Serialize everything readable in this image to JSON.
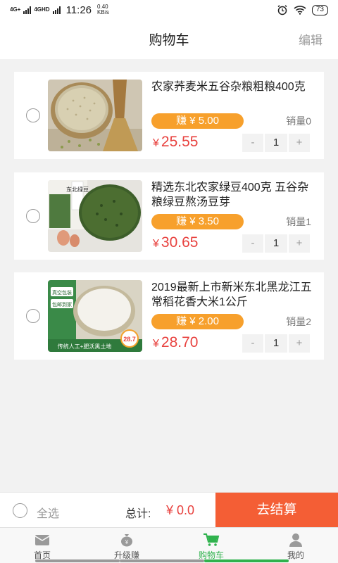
{
  "status": {
    "net1": "4G",
    "net1_sup": "+",
    "net2": "4G",
    "net2_sup": "HD",
    "time": "11:26",
    "speed_value": "0.40",
    "speed_unit": "KB/s",
    "battery": "73"
  },
  "header": {
    "title": "购物车",
    "edit_label": "编辑"
  },
  "items": [
    {
      "name": "农家荞麦米五谷杂粮粗粮400克",
      "earn": "赚 ¥ 5.00",
      "sales": "销量0",
      "currency": "¥",
      "price": "25.55",
      "minus": "-",
      "qty": "1",
      "plus": "+"
    },
    {
      "name": "精选东北农家绿豆400克 五谷杂粮绿豆熬汤豆芽",
      "earn": "赚 ¥ 3.50",
      "sales": "销量1",
      "currency": "¥",
      "price": "30.65",
      "minus": "-",
      "qty": "1",
      "plus": "+"
    },
    {
      "name": "2019最新上市新米东北黑龙江五常稻花香大米1公斤",
      "earn": "赚 ¥ 2.00",
      "sales": "销量2",
      "currency": "¥",
      "price": "28.70",
      "minus": "-",
      "qty": "1",
      "plus": "+"
    }
  ],
  "item3_image_text": {
    "badge1": "真空包装",
    "badge2": "包邮到家",
    "banner": "传统人工+肥沃黑土地",
    "sticker": "28.7"
  },
  "item2_image_text": {
    "bag": "东北绿豆"
  },
  "footer": {
    "select_all": "全选",
    "total_label": "总计:",
    "total_amount": "¥ 0.0",
    "checkout": "去结算"
  },
  "tabs": [
    {
      "label": "首页",
      "icon": "mail-icon"
    },
    {
      "label": "升级赚",
      "icon": "money-bag-icon"
    },
    {
      "label": "购物车",
      "icon": "cart-icon"
    },
    {
      "label": "我的",
      "icon": "user-icon"
    }
  ],
  "colors": {
    "accent": "#f45e35",
    "price": "#e8413e",
    "earn_badge": "#f7a02c",
    "active_tab": "#2fb24d"
  }
}
